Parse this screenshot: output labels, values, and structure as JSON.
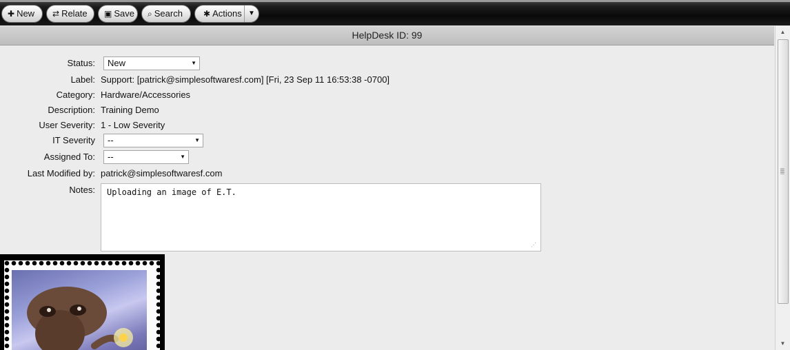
{
  "toolbar": {
    "new_label": "New",
    "relate_label": "Relate",
    "save_label": "Save",
    "search_label": "Search",
    "actions_label": "Actions"
  },
  "header": {
    "title": "HelpDesk ID: 99"
  },
  "form": {
    "status": {
      "label": "Status:",
      "value": "New"
    },
    "label": {
      "label": "Label:",
      "value": "Support: [patrick@simplesoftwaresf.com] [Fri, 23 Sep 11 16:53:38 -0700]"
    },
    "category": {
      "label": "Category:",
      "value": "Hardware/Accessories"
    },
    "description": {
      "label": "Description:",
      "value": "Training Demo"
    },
    "user_severity": {
      "label": "User Severity:",
      "value": "1 - Low Severity"
    },
    "it_severity": {
      "label": "IT Severity",
      "value": "--"
    },
    "assigned_to": {
      "label": "Assigned To:",
      "value": "--"
    },
    "last_modified_by": {
      "label": "Last Modified by:",
      "value": "patrick@simplesoftwaresf.com"
    },
    "notes": {
      "label": "Notes:",
      "value": "Uploading an image of E.T."
    }
  },
  "icons": {
    "new": "plus-icon",
    "relate": "relate-arrows-icon",
    "save": "floppy-icon",
    "search": "magnifier-icon",
    "actions": "gear-icon"
  }
}
